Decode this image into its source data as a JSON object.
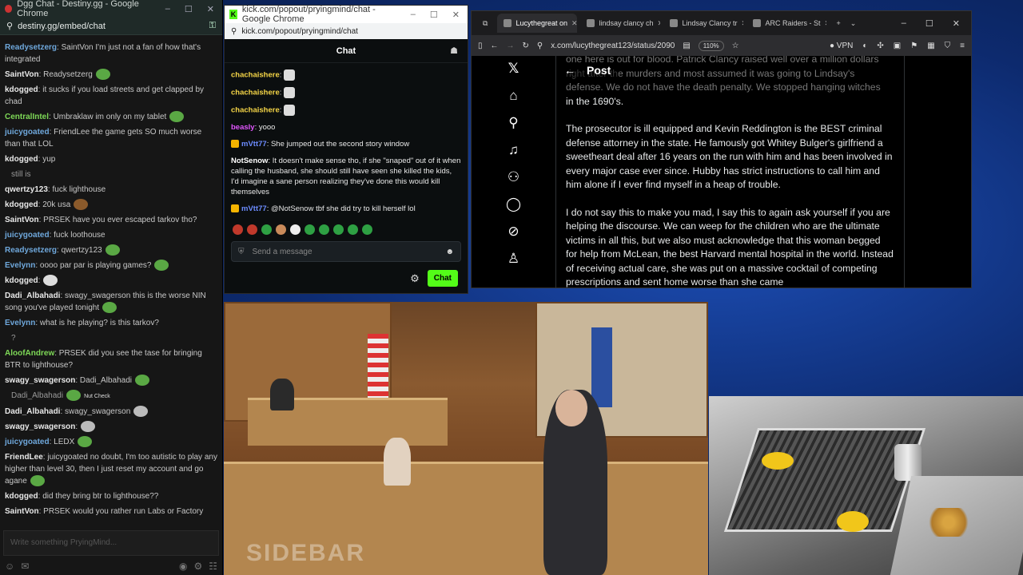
{
  "dgg": {
    "title": "Dgg Chat - Destiny.gg - Google Chrome",
    "url": "destiny.gg/embed/chat",
    "messages": [
      {
        "user": "Readysetzerg",
        "color": "#6fa8dc",
        "text": ": SaintVon I'm just not a fan of how that's integrated"
      },
      {
        "user": "SaintVon",
        "color": "#e8e8e8",
        "text": ": Readysetzerg"
      },
      {
        "user": "kdogged",
        "color": "#e8e8e8",
        "text": ": it sucks if you load streets and get clapped by chad"
      },
      {
        "user": "CentralIntel",
        "color": "#7ed957",
        "text": ": Umbraklaw im only on my tablet"
      },
      {
        "user": "juicygoated",
        "color": "#6fa8dc",
        "text": ": FriendLee the game gets SO much worse than that LOL"
      },
      {
        "user": "kdogged",
        "color": "#e8e8e8",
        "text": ": yup"
      },
      {
        "user": "",
        "color": "#9a9a9a",
        "text": "still is"
      },
      {
        "user": "qwertzy123",
        "color": "#e8e8e8",
        "text": ": fuck lighthouse"
      },
      {
        "user": "kdogged",
        "color": "#e8e8e8",
        "text": ": 20k usa"
      },
      {
        "user": "SaintVon",
        "color": "#e8e8e8",
        "text": ": PRSEK have you ever escaped tarkov tho?"
      },
      {
        "user": "juicygoated",
        "color": "#6fa8dc",
        "text": ": fuck loothouse"
      },
      {
        "user": "Readysetzerg",
        "color": "#6fa8dc",
        "text": ": qwertzy123"
      },
      {
        "user": "Evelynn",
        "color": "#6fa8dc",
        "text": ": oooo par par is playing games?"
      },
      {
        "user": "kdogged",
        "color": "#e8e8e8",
        "text": ":"
      },
      {
        "user": "Dadi_Albahadi",
        "color": "#e8e8e8",
        "text": ": swagy_swagerson this is the worse NIN song you've played tonight"
      },
      {
        "user": "Evelynn",
        "color": "#6fa8dc",
        "text": ": what is he playing? is this tarkov?"
      },
      {
        "user": "",
        "color": "#9a9a9a",
        "text": "?"
      },
      {
        "user": "AloofAndrew",
        "color": "#7ed957",
        "text": ": PRSEK did you see the tase for bringing BTR to lighthouse?"
      },
      {
        "user": "swagy_swagerson",
        "color": "#e8e8e8",
        "text": ": Dadi_Albahadi"
      },
      {
        "user": "",
        "color": "#9a9a9a",
        "text": "Dadi_Albahadi"
      },
      {
        "user": "Dadi_Albahadi",
        "color": "#e8e8e8",
        "text": ": swagy_swagerson"
      },
      {
        "user": "swagy_swagerson",
        "color": "#e8e8e8",
        "text": ":"
      },
      {
        "user": "juicygoated",
        "color": "#6fa8dc",
        "text": ": LEDX"
      },
      {
        "user": "FriendLee",
        "color": "#e8e8e8",
        "text": ": juicygoated no doubt, I'm too autistic to play any higher than level 30, then I just reset my account and go agane"
      },
      {
        "user": "kdogged",
        "color": "#e8e8e8",
        "text": ": did they bring btr to lighthouse??"
      },
      {
        "user": "SaintVon",
        "color": "#e8e8e8",
        "text": ": PRSEK would you rather run Labs or Factory"
      }
    ],
    "emote_note": "Nut Check",
    "input_placeholder": "Write something PryingMind..."
  },
  "kick": {
    "title": "kick.com/popout/pryingmind/chat - Google Chrome",
    "url": "kick.com/popout/pryingmind/chat",
    "header": "Chat",
    "messages": [
      {
        "user": "chachaishere",
        "color": "#f5d547",
        "text": ":",
        "badge": false,
        "hat": true
      },
      {
        "user": "chachaishere",
        "color": "#f5d547",
        "text": ":",
        "badge": false,
        "hat": true
      },
      {
        "user": "chachaishere",
        "color": "#f5d547",
        "text": ":",
        "badge": false,
        "hat": true
      },
      {
        "user": "beasly",
        "color": "#e056fd",
        "text": ": yooo",
        "badge": false,
        "hat": false
      },
      {
        "user": "mVtt77",
        "color": "#6c8cff",
        "text": ": She jumped out the second story window",
        "badge": true,
        "hat": false
      },
      {
        "user": "NotSenow",
        "color": "#ffffff",
        "text": ": It doesn't make sense tho, if she \"snaped\" out of it when calling the husband, she should still have seen she killed the kids, I'd imagine a sane person realizing they've done this would kill themselves",
        "badge": false,
        "hat": false
      },
      {
        "user": "mVtt77",
        "color": "#6c8cff",
        "text": ": @NotSenow tbf she did try to kill herself lol",
        "badge": true,
        "hat": false
      }
    ],
    "input_placeholder": "Send a message",
    "chat_button": "Chat"
  },
  "x": {
    "tabs": [
      {
        "label": "Lucythegreat on",
        "active": true
      },
      {
        "label": "lindsay clancy ch",
        "active": false
      },
      {
        "label": "Lindsay Clancy tr",
        "active": false
      },
      {
        "label": "ARC Raiders - St",
        "active": false
      }
    ],
    "url": "x.com/lucythegreat123/status/2090",
    "zoom": "110%",
    "vpn": "VPN",
    "post_header": "Post",
    "faded_line": "one here is out for blood. Patrick Clancy raised well over a million dollars right after the murders and most assumed it was going to Lindsay's defense. We do not have the death penalty. We stopped hanging witches",
    "paragraphs": [
      "in the 1690's.",
      "The prosecutor is ill equipped and Kevin Reddington is the BEST criminal defense attorney in the state. He famously got Whitey Bulger's girlfriend a sweetheart deal after 16 years on the run with him and has been involved in every major case ever since. Hubby has strict instructions to call him and him alone if I ever find myself in a heap of trouble.",
      "I do not say this to make you mad, I say this to again ask yourself if you are helping the discourse. We can weep for the children who are the ultimate victims in all this, but we also must acknowledge that this woman begged for help from McLean, the best Harvard mental hospital in the world. Instead of receiving actual care, she was put on a massive cocktail of competing prescriptions and sent home worse than she came"
    ]
  },
  "court_video": {
    "watermark": "SIDEBAR"
  }
}
